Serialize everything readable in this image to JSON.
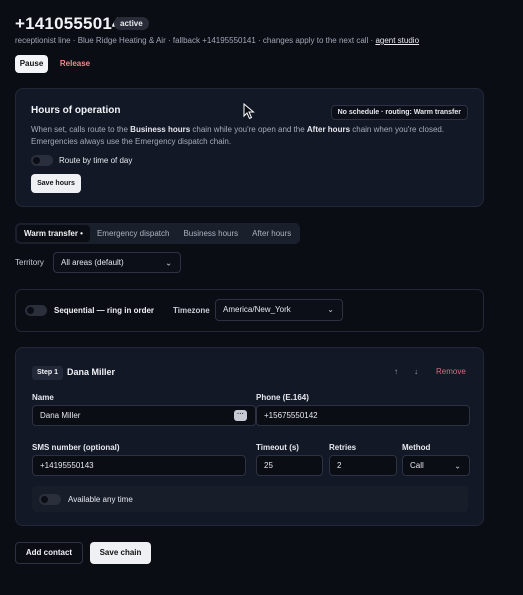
{
  "header": {
    "phone": "+14105550140",
    "status": "active",
    "subline_text": "receptionist line · Blue Ridge Heating & Air · fallback +14195550141 · changes apply to the next call · ",
    "subline_link": "agent studio",
    "pause_label": "Pause",
    "release_label": "Release"
  },
  "hours": {
    "title": "Hours of operation",
    "schedule_badge": "No schedule · routing: Warm transfer",
    "desc_1": "When set, calls route to the ",
    "desc_business": "Business hours",
    "desc_2": " chain while you're open and the ",
    "desc_after": "After hours",
    "desc_3": " chain when you're closed. Emergencies always use the Emergency dispatch chain.",
    "toggle_label": "Route by time of day",
    "save_label": "Save hours"
  },
  "tabs": [
    {
      "label": "Warm transfer •"
    },
    {
      "label": "Emergency dispatch"
    },
    {
      "label": "Business hours"
    },
    {
      "label": "After hours"
    }
  ],
  "territory": {
    "label": "Territory",
    "value": "All areas (default)"
  },
  "sequential": {
    "label": "Sequential — ring in order",
    "timezone_label": "Timezone",
    "timezone_value": "America/New_York"
  },
  "step": {
    "badge": "Step 1",
    "name": "Dana Miller",
    "up": "↑",
    "down": "↓",
    "remove": "Remove",
    "fields": {
      "name_label": "Name",
      "name_value": "Dana Miller",
      "phone_label": "Phone (E.164)",
      "phone_value": "+15675550142",
      "sms_label": "SMS number (optional)",
      "sms_value": "+14195550143",
      "timeout_label": "Timeout (s)",
      "timeout_value": "25",
      "retries_label": "Retries",
      "retries_value": "2",
      "method_label": "Method",
      "method_value": "Call"
    },
    "available_label": "Available any time"
  },
  "footer": {
    "add_label": "Add contact",
    "save_label": "Save chain"
  }
}
